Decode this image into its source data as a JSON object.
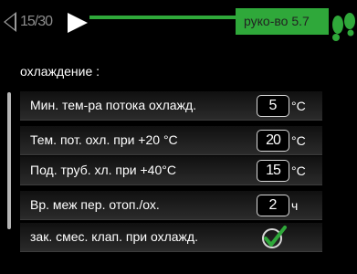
{
  "header": {
    "page_counter": "15/30",
    "guide_label": "руко-во 5.7"
  },
  "section": {
    "title": "охлаждение :"
  },
  "settings": [
    {
      "label": "Мин. тем-ра потока охлажд.",
      "value": "5",
      "unit": "°C"
    },
    {
      "label": "Тем. пот. охл. при +20 °C",
      "value": "20",
      "unit": "°C"
    },
    {
      "label": "Под. труб. хл. при +40°C",
      "value": "15",
      "unit": "°C"
    },
    {
      "label": "Вр. меж пер. отоп./ох.",
      "value": "2",
      "unit": "ч"
    },
    {
      "label": "зак. смес. клап. при охлажд.",
      "checked": true
    }
  ],
  "colors": {
    "accent": "#2fa83a",
    "background": "#000000",
    "text": "#ffffff"
  },
  "icons": [
    "nav-left-icon",
    "nav-right-icon",
    "footsteps-icon",
    "checkmark-icon"
  ]
}
